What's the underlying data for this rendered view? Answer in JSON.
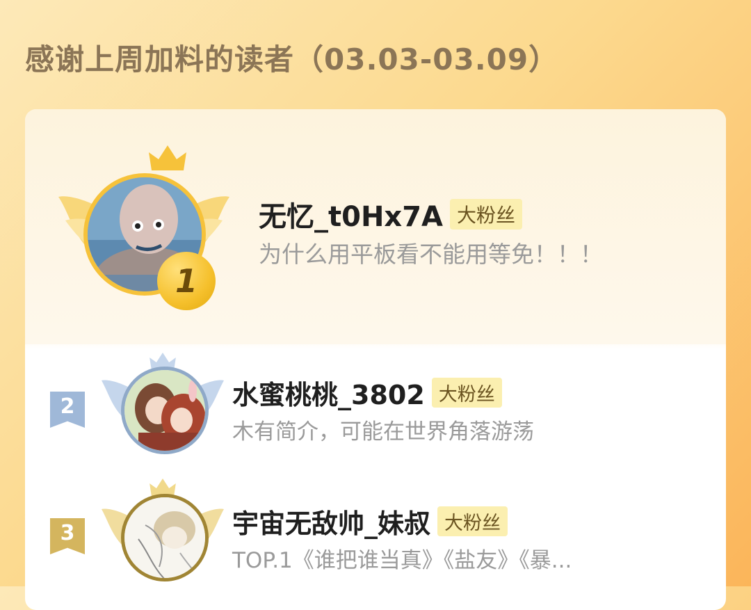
{
  "header": {
    "title": "感谢上周加料的读者（03.03-03.09）"
  },
  "ranking": {
    "items": [
      {
        "rank": "1",
        "name": "无忆_t0Hx7A",
        "tag": "大粉丝",
        "desc": "为什么用平板看不能用等免！！！"
      },
      {
        "rank": "2",
        "name": "水蜜桃桃_3802",
        "tag": "大粉丝",
        "desc": "木有简介，可能在世界角落游荡"
      },
      {
        "rank": "3",
        "name": "宇宙无敌帅_妹叔",
        "tag": "大粉丝",
        "desc": "TOP.1《谁把谁当真》《盐友》《暴..."
      }
    ]
  },
  "colors": {
    "accent_gold": "#f6c23a",
    "silver": "#9fb8d8",
    "bronze": "#d9b55a",
    "tag_bg": "#fbefb0"
  }
}
